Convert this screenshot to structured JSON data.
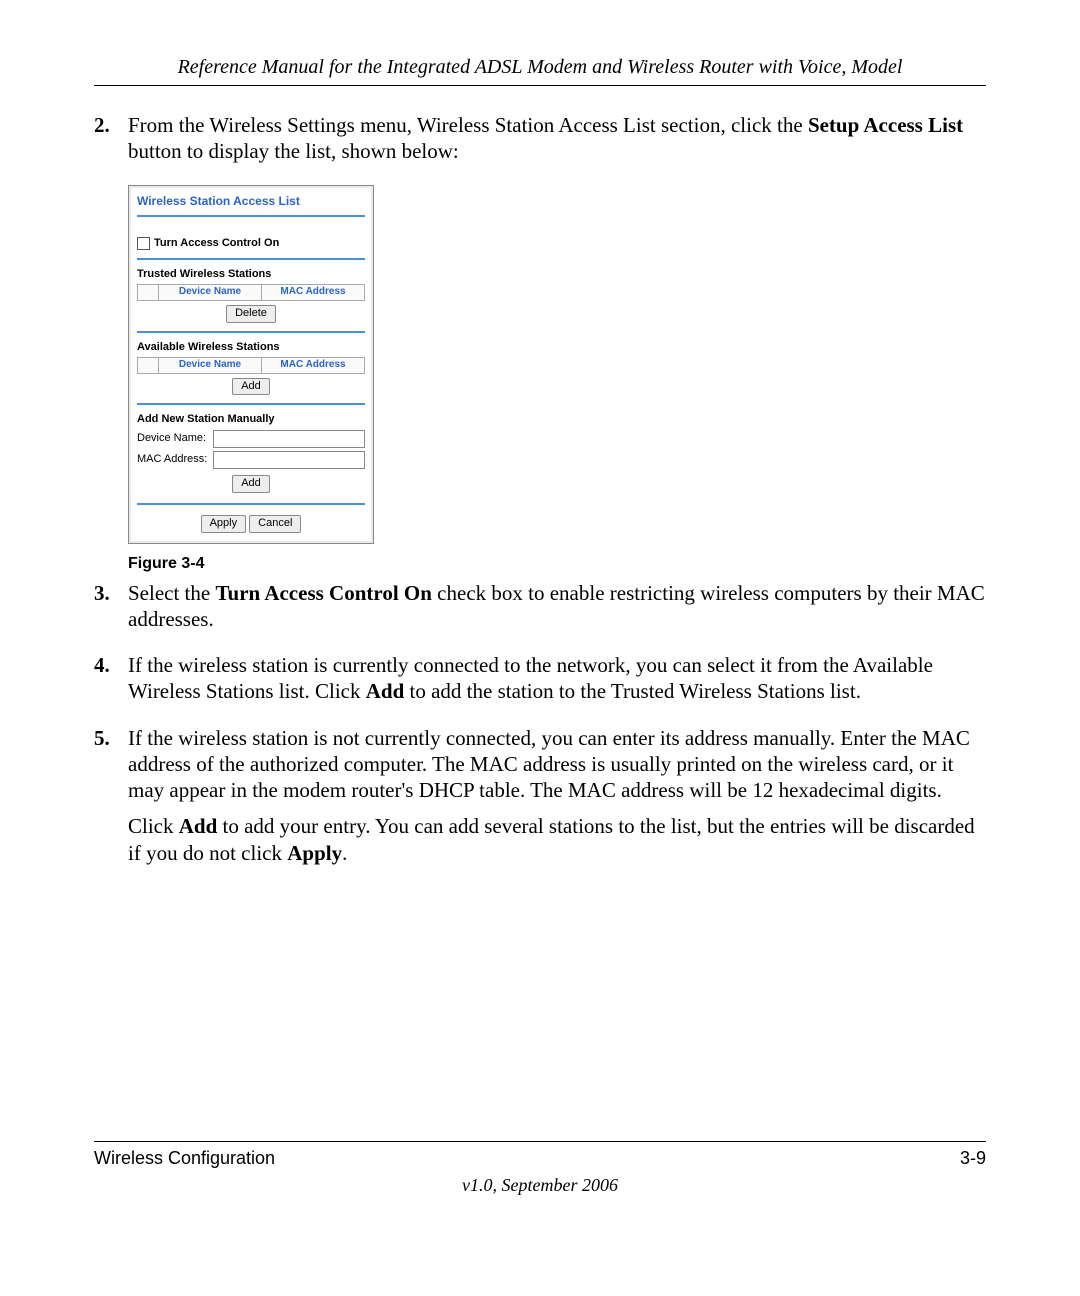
{
  "header": {
    "title": "Reference Manual for the Integrated ADSL Modem and Wireless Router with Voice, Model"
  },
  "steps": {
    "s2_num": "2.",
    "s2_a": "From the Wireless Settings menu, Wireless Station Access List section, click the ",
    "s2_bold": "Setup Access List",
    "s2_b": " button to display the list, shown below:",
    "s3_num": "3.",
    "s3_a": "Select the ",
    "s3_bold": "Turn Access Control On",
    "s3_b": " check box to enable restricting wireless computers by their MAC addresses.",
    "s4_num": "4.",
    "s4_a": "If the wireless station is currently connected to the network, you can select it from the Available Wireless Stations list. Click ",
    "s4_bold": "Add",
    "s4_b": " to add the station to the Trusted Wireless Stations list.",
    "s5_num": "5.",
    "s5_a": "If the wireless station is not currently connected, you can enter its address manually. Enter the MAC address of the authorized computer. The MAC address is usually printed on the wireless card, or it may appear in the modem router's DHCP table. The MAC address will be 12 hexadecimal digits.",
    "s5p2_a": "Click ",
    "s5p2_bold1": "Add",
    "s5p2_b": " to add your entry. You can add several stations to the list, but the entries will be discarded if you do not click ",
    "s5p2_bold2": "Apply",
    "s5p2_c": "."
  },
  "figure": {
    "caption": "Figure 3-4"
  },
  "ui": {
    "title": "Wireless Station Access List",
    "cb_label": "Turn Access Control On",
    "trusted_hdr": "Trusted Wireless Stations",
    "col_device": "Device Name",
    "col_mac": "MAC Address",
    "delete_btn": "Delete",
    "avail_hdr": "Available Wireless Stations",
    "add_btn": "Add",
    "manual_hdr": "Add New Station Manually",
    "lbl_device": "Device Name:",
    "lbl_mac": "MAC Address:",
    "apply_btn": "Apply",
    "cancel_btn": "Cancel"
  },
  "footer": {
    "section": "Wireless Configuration",
    "page": "3-9",
    "version": "v1.0, September 2006"
  }
}
